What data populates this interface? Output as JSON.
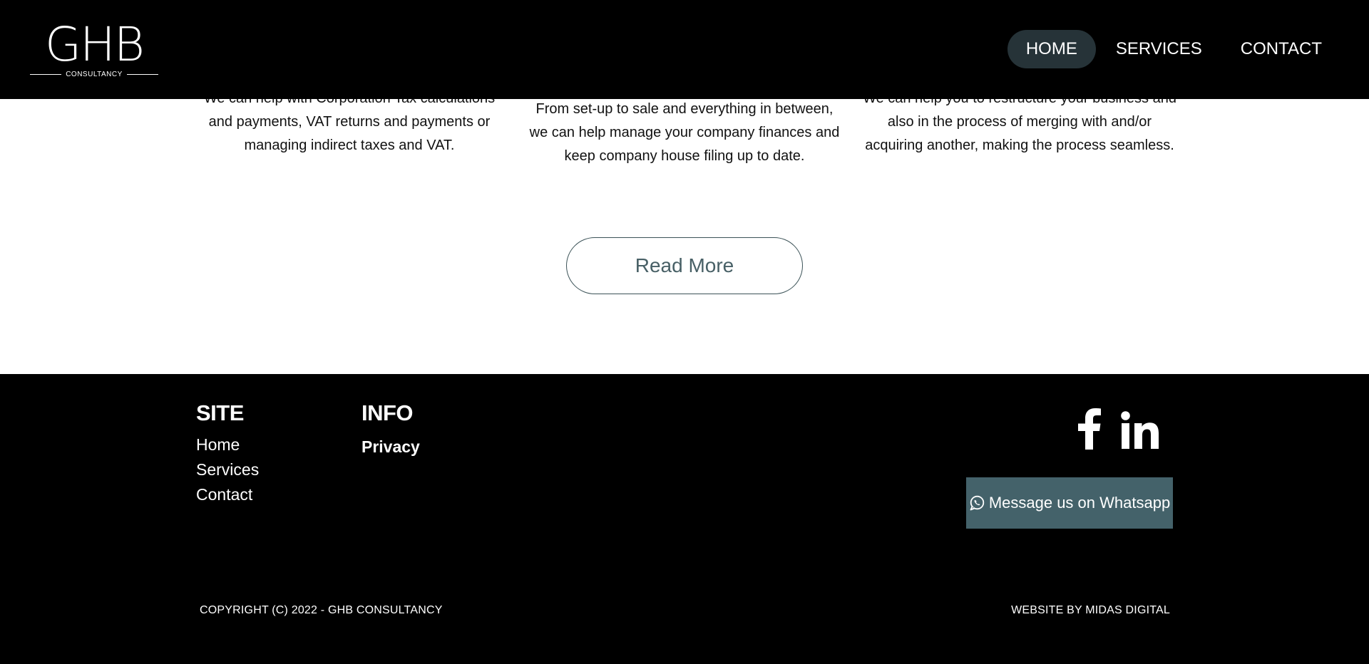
{
  "header": {
    "logo": {
      "mark": "GHB",
      "subtitle": "CONSULTANCY"
    },
    "nav": [
      {
        "label": "HOME",
        "active": true
      },
      {
        "label": "SERVICES",
        "active": false
      },
      {
        "label": "CONTACT",
        "active": false
      }
    ]
  },
  "services": {
    "items": [
      {
        "text": "We can help with Corporation Tax calculations and payments, VAT returns and payments or managing indirect taxes and VAT."
      },
      {
        "text": "From set-up to sale and everything in between, we can help manage your company finances and keep company house filing up to date."
      },
      {
        "text": "We can help you to restructure your business and also in the process of merging with and/or acquiring another, making the process seamless."
      }
    ],
    "read_more_label": "Read More"
  },
  "footer": {
    "site": {
      "heading": "SITE",
      "links": [
        "Home",
        "Services",
        "Contact"
      ]
    },
    "info": {
      "heading": "INFO",
      "links": [
        "Privacy"
      ]
    },
    "social": [
      {
        "icon": "facebook-icon"
      },
      {
        "icon": "linkedin-icon"
      }
    ],
    "whatsapp_label": "Message us on Whatsapp",
    "copyright": "COPYRIGHT (C) 2022 - GHB CONSULTANCY",
    "credit": "WEBSITE BY MIDAS DIGITAL"
  },
  "colors": {
    "header_bg": "#000000",
    "nav_active_bg": "#263338",
    "accent": "#44626a",
    "read_more_text": "#486066"
  }
}
